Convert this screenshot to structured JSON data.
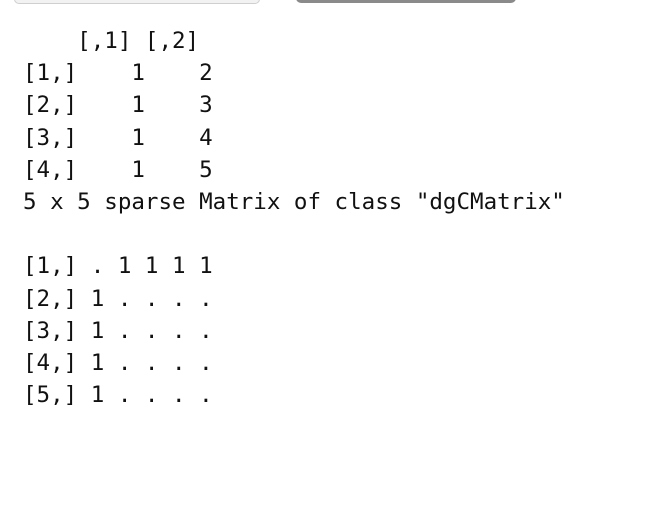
{
  "console": {
    "lines": [
      "    [,1] [,2]",
      "[1,]    1    2",
      "[2,]    1    3",
      "[3,]    1    4",
      "[4,]    1    5",
      "5 x 5 sparse Matrix of class \"dgCMatrix\"",
      "",
      "[1,] . 1 1 1 1",
      "[2,] 1 . . . .",
      "[3,] 1 . . . .",
      "[4,] 1 . . . .",
      "[5,] 1 . . . ."
    ]
  }
}
